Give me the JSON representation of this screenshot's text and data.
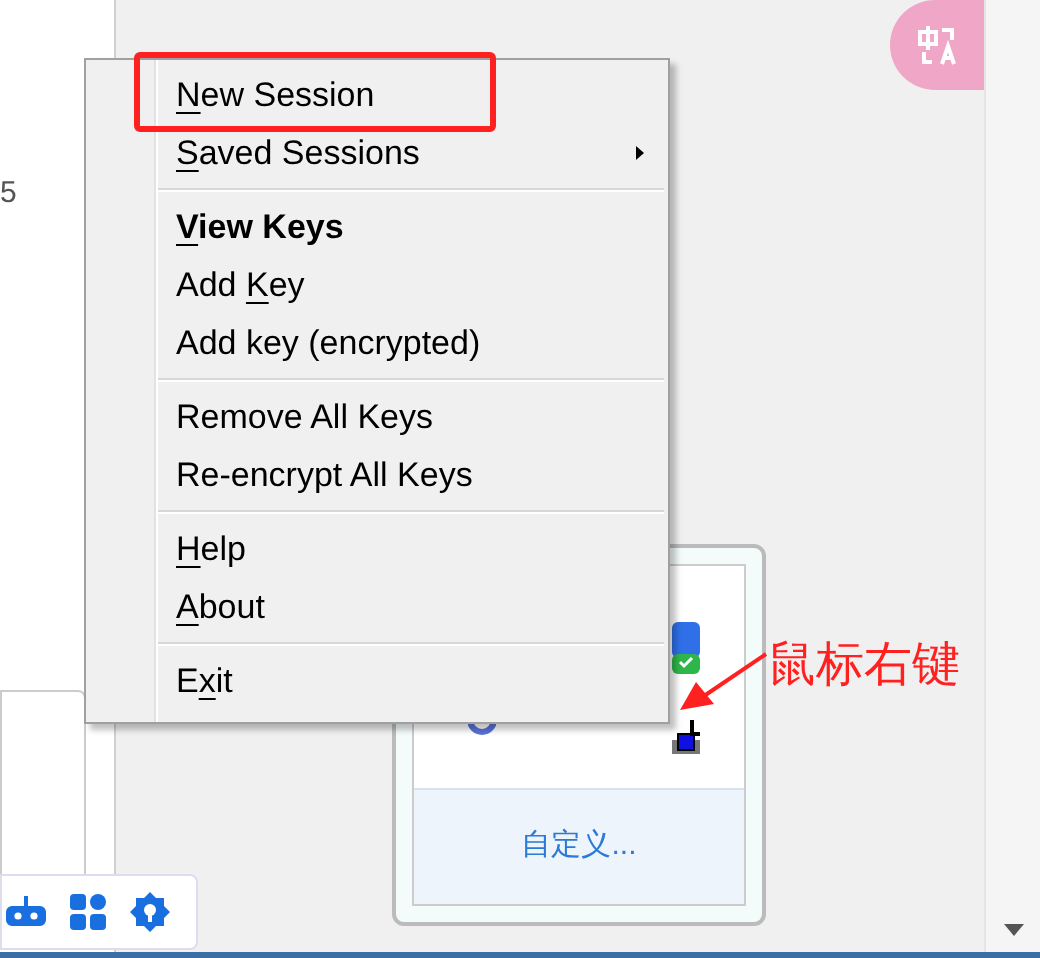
{
  "side_panel": {
    "text": "5"
  },
  "context_menu": {
    "groups": [
      [
        {
          "label": {
            "access_key": "N",
            "after": "ew Session"
          },
          "highlighted": true,
          "bold": false,
          "submenu": false
        },
        {
          "label": {
            "access_key": "S",
            "after": "aved Sessions"
          },
          "highlighted": false,
          "bold": false,
          "submenu": true
        }
      ],
      [
        {
          "label": {
            "access_key": "V",
            "after": "iew Keys"
          },
          "highlighted": false,
          "bold": true,
          "submenu": false
        },
        {
          "label": {
            "before": "Add ",
            "access_key": "K",
            "after": "ey"
          },
          "highlighted": false,
          "bold": false,
          "submenu": false
        },
        {
          "label": {
            "before": "Add key (encrypted)"
          },
          "highlighted": false,
          "bold": false,
          "submenu": false
        }
      ],
      [
        {
          "label": {
            "before": "Remove All Keys"
          },
          "highlighted": false,
          "bold": false,
          "submenu": false
        },
        {
          "label": {
            "before": "Re-encrypt All Keys"
          },
          "highlighted": false,
          "bold": false,
          "submenu": false
        }
      ],
      [
        {
          "label": {
            "access_key": "H",
            "after": "elp"
          },
          "highlighted": false,
          "bold": false,
          "submenu": false
        },
        {
          "label": {
            "access_key": "A",
            "after": "bout"
          },
          "highlighted": false,
          "bold": false,
          "submenu": false
        }
      ],
      [
        {
          "label": {
            "before": "E",
            "access_key": "x",
            "after": "it"
          },
          "highlighted": false,
          "bold": false,
          "submenu": false
        }
      ]
    ]
  },
  "tray_popup": {
    "link": "自定义..."
  },
  "annotation": {
    "text": "鼠标右键"
  }
}
